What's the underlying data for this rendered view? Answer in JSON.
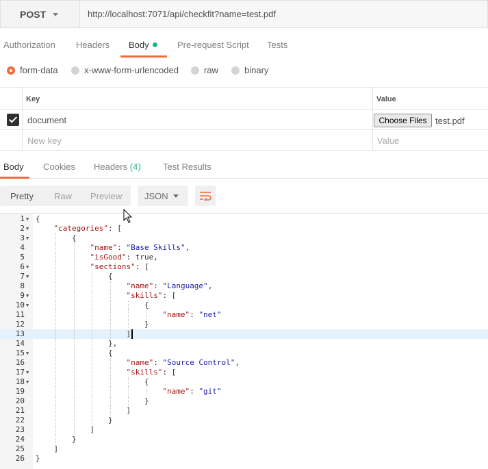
{
  "request": {
    "method": "POST",
    "url": "http://localhost:7071/api/checkfit?name=test.pdf"
  },
  "request_tabs": [
    "Authorization",
    "Headers",
    "Body",
    "Pre-request Script",
    "Tests"
  ],
  "body_types": [
    "form-data",
    "x-www-form-urlencoded",
    "raw",
    "binary"
  ],
  "form_table": {
    "key_header": "Key",
    "value_header": "Value",
    "row_key": "document",
    "choose_files": "Choose Files",
    "file_name": "test.pdf",
    "new_key_placeholder": "New key",
    "new_value_placeholder": "Value"
  },
  "response_tabs": {
    "body": "Body",
    "cookies": "Cookies",
    "headers": "Headers",
    "headers_count": "(4)",
    "test_results": "Test Results"
  },
  "view_modes": [
    "Pretty",
    "Raw",
    "Preview"
  ],
  "format": "JSON",
  "icons": {
    "method_caret": "chevron-down-icon",
    "format_caret": "chevron-down-icon",
    "wrap": "wrap-lines-icon",
    "checkbox": "checkbox-checked-icon",
    "pointer": "mouse-pointer-icon"
  },
  "colors": {
    "accent": "#f26b3a",
    "success": "#26b47f"
  },
  "editor": {
    "current_line": 13,
    "lines": [
      {
        "n": "1",
        "fold": true,
        "text": "{"
      },
      {
        "n": "2",
        "fold": true,
        "text": "    \"categories\": ["
      },
      {
        "n": "3",
        "fold": true,
        "text": "        {"
      },
      {
        "n": "4",
        "fold": false,
        "text": "            \"name\": \"Base Skills\","
      },
      {
        "n": "5",
        "fold": false,
        "text": "            \"isGood\": true,"
      },
      {
        "n": "6",
        "fold": true,
        "text": "            \"sections\": ["
      },
      {
        "n": "7",
        "fold": true,
        "text": "                {"
      },
      {
        "n": "8",
        "fold": false,
        "text": "                    \"name\": \"Language\","
      },
      {
        "n": "9",
        "fold": true,
        "text": "                    \"skills\": ["
      },
      {
        "n": "10",
        "fold": true,
        "text": "                        {"
      },
      {
        "n": "11",
        "fold": false,
        "text": "                            \"name\": \"net\""
      },
      {
        "n": "12",
        "fold": false,
        "text": "                        }"
      },
      {
        "n": "13",
        "fold": false,
        "text": "                    ]"
      },
      {
        "n": "14",
        "fold": false,
        "text": "                },"
      },
      {
        "n": "15",
        "fold": true,
        "text": "                {"
      },
      {
        "n": "16",
        "fold": false,
        "text": "                    \"name\": \"Source Control\","
      },
      {
        "n": "17",
        "fold": true,
        "text": "                    \"skills\": ["
      },
      {
        "n": "18",
        "fold": true,
        "text": "                        {"
      },
      {
        "n": "19",
        "fold": false,
        "text": "                            \"name\": \"git\""
      },
      {
        "n": "20",
        "fold": false,
        "text": "                        }"
      },
      {
        "n": "21",
        "fold": false,
        "text": "                    ]"
      },
      {
        "n": "22",
        "fold": false,
        "text": "                }"
      },
      {
        "n": "23",
        "fold": false,
        "text": "            ]"
      },
      {
        "n": "24",
        "fold": false,
        "text": "        }"
      },
      {
        "n": "25",
        "fold": false,
        "text": "    ]"
      },
      {
        "n": "26",
        "fold": false,
        "text": "}"
      }
    ]
  }
}
